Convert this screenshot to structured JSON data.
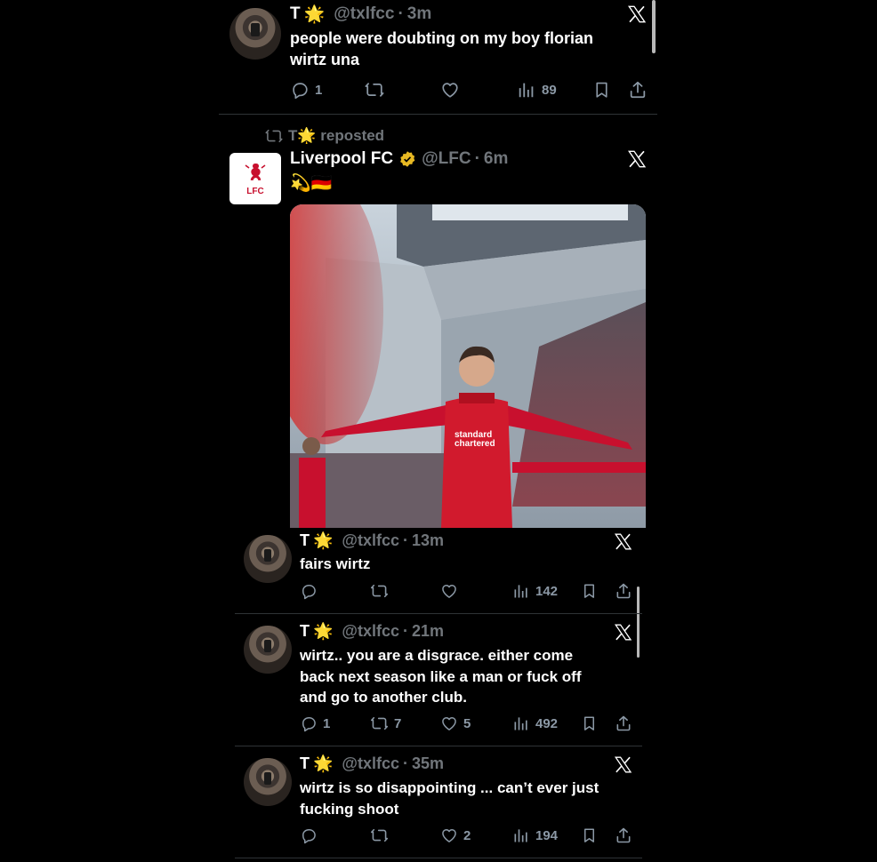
{
  "posts": [
    {
      "name": "T",
      "emoji": "🌟",
      "handle": "@txlfcc",
      "dot": "·",
      "time": "3m",
      "text_lines": [
        "people were doubting on my boy florian",
        "wirtz una"
      ],
      "replies": "1",
      "reposts": "",
      "likes": "",
      "views": "89"
    },
    {
      "repost_label": "T🌟 reposted",
      "name": "Liverpool FC",
      "handle": "@LFC",
      "dot": "·",
      "time": "6m",
      "text": "💫🇩🇪",
      "logo_text": "LFC",
      "image_alt": "player celebrating at stadium",
      "shirt_sponsor": "standard chartered"
    },
    {
      "name": "T",
      "emoji": "🌟",
      "handle": "@txlfcc",
      "dot": "·",
      "time": "13m",
      "text_lines": [
        "fairs wirtz"
      ],
      "replies": "",
      "reposts": "",
      "likes": "",
      "views": "142"
    },
    {
      "name": "T",
      "emoji": "🌟",
      "handle": "@txlfcc",
      "dot": "·",
      "time": "21m",
      "text_lines": [
        "wirtz.. you are a disgrace. either come",
        "back next season like a man or fuck off",
        "and go to another club."
      ],
      "replies": "1",
      "reposts": "7",
      "likes": "5",
      "views": "492"
    },
    {
      "name": "T",
      "emoji": "🌟",
      "handle": "@txlfcc",
      "dot": "·",
      "time": "35m",
      "text_lines": [
        "wirtz is so disappointing ... can’t ever just",
        "fucking shoot"
      ],
      "replies": "",
      "reposts": "",
      "likes": "2",
      "views": "194"
    }
  ],
  "icons": {
    "reply": "reply-icon",
    "repost": "repost-icon",
    "like": "like-icon",
    "views": "views-icon",
    "bookmark": "bookmark-icon",
    "share": "share-icon",
    "x_logo": "x-logo-icon",
    "verified": "verified-badge-icon"
  },
  "colors": {
    "background": "#000000",
    "muted": "#71767b",
    "icon": "#8b98a5",
    "divider": "#2f3336",
    "lfc_red": "#c8102e",
    "verified_gold": "#e8b923"
  }
}
